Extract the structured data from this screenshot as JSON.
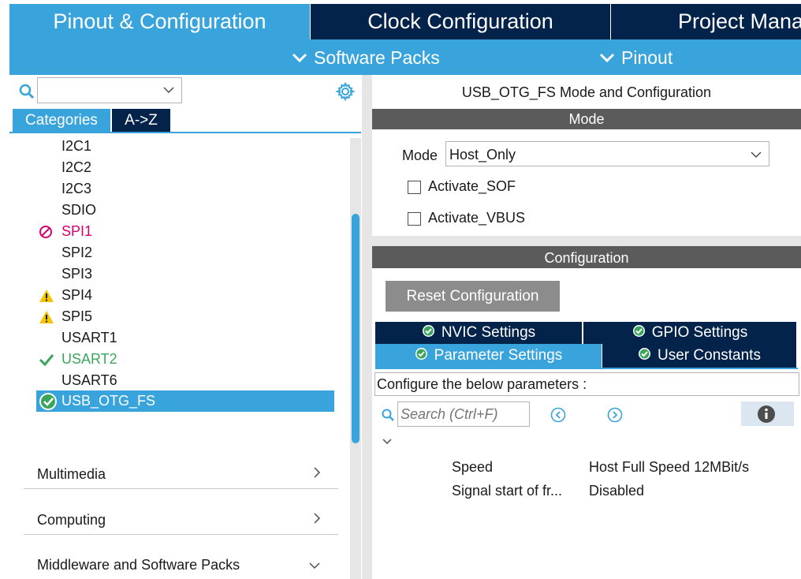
{
  "top_tabs": {
    "pinout_config": "Pinout & Configuration",
    "clock_config": "Clock Configuration",
    "project_manager": "Project Manager"
  },
  "subbar": {
    "software_packs": "Software Packs",
    "pinout": "Pinout"
  },
  "left": {
    "search_value": "",
    "tabs": {
      "categories": "Categories",
      "az": "A->Z"
    },
    "peripherals": [
      {
        "label": "I2C1",
        "status": "none"
      },
      {
        "label": "I2C2",
        "status": "none"
      },
      {
        "label": "I2C3",
        "status": "none"
      },
      {
        "label": "SDIO",
        "status": "none"
      },
      {
        "label": "SPI1",
        "status": "disabled"
      },
      {
        "label": "SPI2",
        "status": "none"
      },
      {
        "label": "SPI3",
        "status": "none"
      },
      {
        "label": "SPI4",
        "status": "warning"
      },
      {
        "label": "SPI5",
        "status": "warning"
      },
      {
        "label": "USART1",
        "status": "none"
      },
      {
        "label": "USART2",
        "status": "ok"
      },
      {
        "label": "USART6",
        "status": "none"
      },
      {
        "label": "USB_OTG_FS",
        "status": "selected"
      }
    ],
    "groups": {
      "multimedia": "Multimedia",
      "computing": "Computing",
      "middleware": "Middleware and Software Packs"
    }
  },
  "right": {
    "title": "USB_OTG_FS Mode and Configuration",
    "mode_header": "Mode",
    "mode_label": "Mode",
    "mode_value": "Host_Only",
    "activate_sof": "Activate_SOF",
    "activate_vbus": "Activate_VBUS",
    "config_header": "Configuration",
    "reset_button": "Reset Configuration",
    "tabs": {
      "nvic": "NVIC Settings",
      "gpio": "GPIO Settings",
      "parameter": "Parameter Settings",
      "user_constants": "User Constants"
    },
    "configure_text": "Configure the below parameters :",
    "search_placeholder": "Search (Ctrl+F)",
    "params": [
      {
        "name": "Speed",
        "value": "Host Full Speed 12MBit/s"
      },
      {
        "name": "Signal start of fr...",
        "value": "Disabled"
      }
    ]
  },
  "colors": {
    "accent_blue": "#39a4dc",
    "navy": "#03234b",
    "header_gray": "#5b5b5b",
    "disabled_magenta": "#d6006e",
    "ok_green": "#3ba55c",
    "warning_yellow": "#f5c400"
  }
}
